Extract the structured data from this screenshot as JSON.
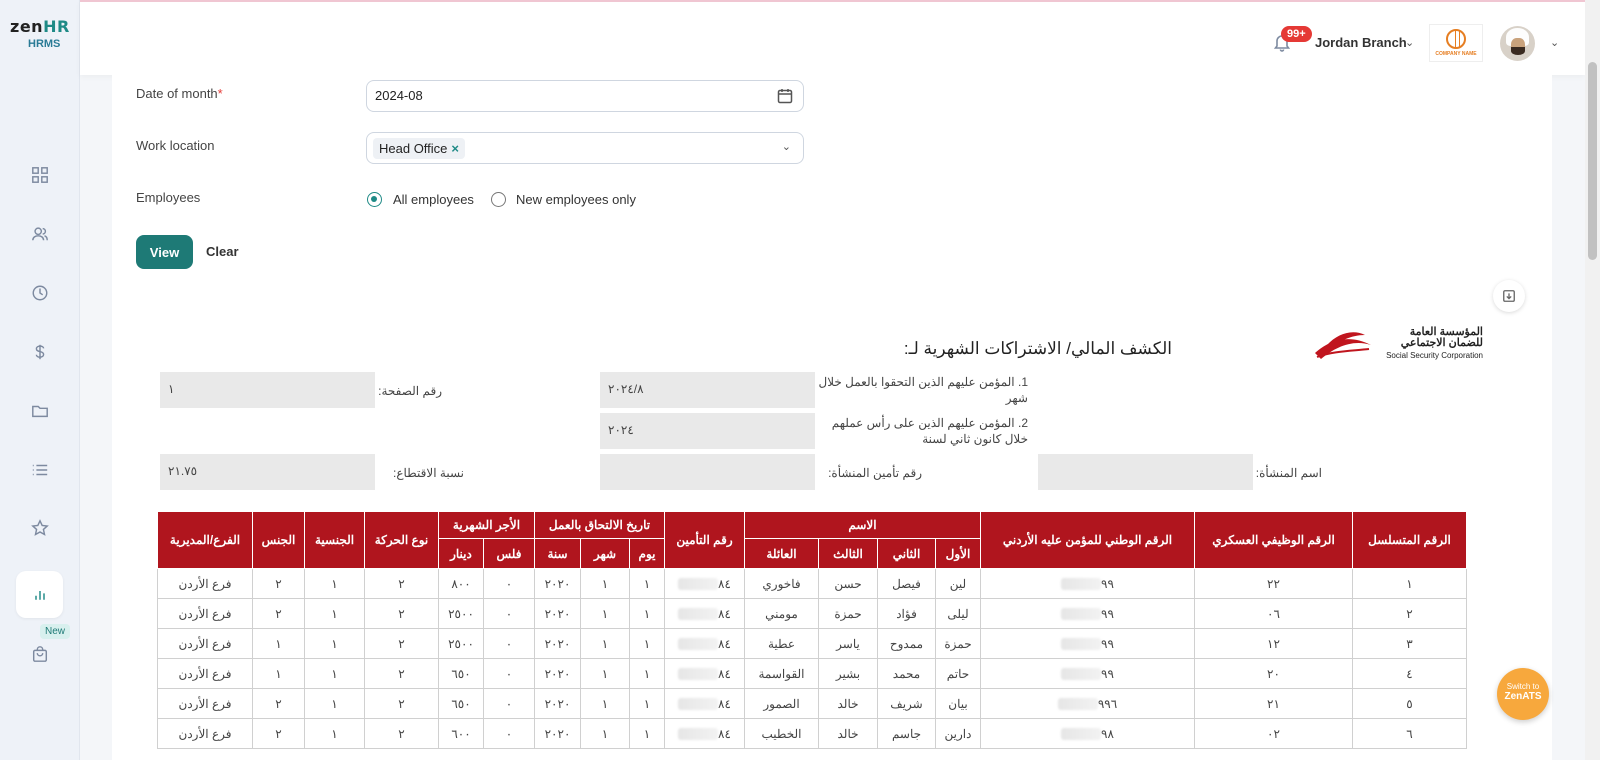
{
  "brand": {
    "logo_main": "zen",
    "logo_hr": "HR",
    "logo_sub": "HRMS"
  },
  "sidebar": {
    "icons": [
      "dashboard-icon",
      "users-icon",
      "clock-icon",
      "dollar-icon",
      "folder-icon",
      "list-icon",
      "star-icon",
      "chart-icon",
      "shopping-bag-icon"
    ],
    "new_badge": "New"
  },
  "header": {
    "notifications": "99+",
    "branch": "Jordan Branch",
    "company_logo_text": "COMPANY NAME"
  },
  "form": {
    "date_label": "Date of month",
    "date_required": "*",
    "date_value": "2024-08",
    "location_label": "Work location",
    "location_chip": "Head Office",
    "location_chip_remove": "×",
    "employees_label": "Employees",
    "radio_all": "All employees",
    "radio_new": "New employees only",
    "selected": "all",
    "view_button": "View",
    "clear_button": "Clear"
  },
  "report": {
    "title": "الكشف المالي/ الاشتراكات الشهرية لـ:",
    "ssc_ar": "المؤسسة العامة للضمان الاجتماعي",
    "ssc_en": "Social Security Corporation",
    "label_joined": "1. المؤمن عليهم الذين التحقوا بالعمل خلال شهر",
    "value_joined": "٢٠٢٤/٨",
    "label_page": "رقم الصفحة:",
    "value_page": "١",
    "label_onhead": "2. المؤمن عليهم الذين على رأس عملهم خلال كانون ثاني لسنة",
    "value_onhead": "٢٠٢٤",
    "label_est_name": "اسم المنشأة:",
    "value_est_name": "",
    "label_est_no": "رقم تأمين المنشأة:",
    "value_est_no": "",
    "label_rate": "نسبة الاقتطاع:",
    "value_rate": "٢١.٧٥"
  },
  "table": {
    "headers": {
      "serial": "الرقم المتسلسل",
      "military": "الرقم الوظيفي العسكري",
      "national": "الرقم الوطني للمؤمن عليه الأردني",
      "name": "الاسم",
      "first": "الأول",
      "second": "الثاني",
      "third": "الثالث",
      "family": "العائلة",
      "insurance": "رقم التأمين",
      "join_date": "تاريخ الالتحاق بالعمل",
      "day": "يوم",
      "month": "شهر",
      "year": "سنة",
      "wage": "الأجر الشهرية",
      "fils": "فلس",
      "dinar": "دينار",
      "movement": "نوع الحركة",
      "nationality": "الجنسية",
      "gender": "الجنس",
      "branch": "الفرع/المديرية"
    },
    "rows": [
      {
        "serial": "١",
        "military": "٢٢",
        "national": "٩٩",
        "first": "لين",
        "second": "فيصل",
        "third": "حسن",
        "family": "فاخوري",
        "insurance": "٨٤",
        "day": "١",
        "month": "١",
        "year": "٢٠٢٠",
        "fils": "٠",
        "dinar": "٨٠٠",
        "movement": "٢",
        "nationality": "١",
        "gender": "٢",
        "branch": "فرع الأردن"
      },
      {
        "serial": "٢",
        "military": "٠٦",
        "national": "٩٩",
        "first": "ليلى",
        "second": "فؤاد",
        "third": "حمزة",
        "family": "مومني",
        "insurance": "٨٤",
        "day": "١",
        "month": "١",
        "year": "٢٠٢٠",
        "fils": "٠",
        "dinar": "٢٥٠٠",
        "movement": "٢",
        "nationality": "١",
        "gender": "٢",
        "branch": "فرع الأردن"
      },
      {
        "serial": "٣",
        "military": "١٢",
        "national": "٩٩",
        "first": "حمزة",
        "second": "ممدوح",
        "third": "ياسر",
        "family": "عطية",
        "insurance": "٨٤",
        "day": "١",
        "month": "١",
        "year": "٢٠٢٠",
        "fils": "٠",
        "dinar": "٢٥٠٠",
        "movement": "٢",
        "nationality": "١",
        "gender": "١",
        "branch": "فرع الأردن"
      },
      {
        "serial": "٤",
        "military": "٢٠",
        "national": "٩٩",
        "first": "حاتم",
        "second": "محمد",
        "third": "بشير",
        "family": "القواسمة",
        "insurance": "٨٤",
        "day": "١",
        "month": "١",
        "year": "٢٠٢٠",
        "fils": "٠",
        "dinar": "٦٥٠",
        "movement": "٢",
        "nationality": "١",
        "gender": "١",
        "branch": "فرع الأردن"
      },
      {
        "serial": "٥",
        "military": "٢١",
        "national": "٩٩٦",
        "first": "بيان",
        "second": "شريف",
        "third": "خالد",
        "family": "الصمور",
        "insurance": "٨٤",
        "day": "١",
        "month": "١",
        "year": "٢٠٢٠",
        "fils": "٠",
        "dinar": "٦٥٠",
        "movement": "٢",
        "nationality": "١",
        "gender": "٢",
        "branch": "فرع الأردن"
      },
      {
        "serial": "٦",
        "military": "٠٢",
        "national": "٩٨",
        "first": "دارين",
        "second": "جاسم",
        "third": "خالد",
        "family": "الخطيب",
        "insurance": "٨٤",
        "day": "١",
        "month": "١",
        "year": "٢٠٢٠",
        "fils": "٠",
        "dinar": "٦٠٠",
        "movement": "٢",
        "nationality": "١",
        "gender": "٢",
        "branch": "فرع الأردن"
      }
    ]
  },
  "switch_button": {
    "line1": "Switch to",
    "line2": "ZenATS"
  },
  "colors": {
    "accent": "#1e7a76",
    "table_header": "#b0151e",
    "switch": "#f7a83d",
    "notif": "#e53935"
  }
}
